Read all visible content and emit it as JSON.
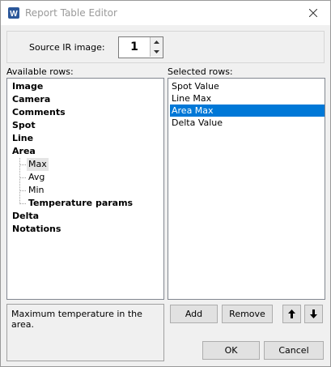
{
  "window": {
    "title": "Report Table Editor"
  },
  "source": {
    "label": "Source IR image:",
    "value": "1"
  },
  "available": {
    "label": "Available rows:",
    "items": [
      "Image",
      "Camera",
      "Comments",
      "Spot",
      "Line",
      "Area"
    ],
    "area_children": [
      "Max",
      "Avg",
      "Min",
      "Temperature params"
    ],
    "after": [
      "Delta",
      "Notations"
    ]
  },
  "selected": {
    "label": "Selected rows:",
    "items": [
      "Spot Value",
      "Line Max",
      "Area Max",
      "Delta Value"
    ],
    "selected_item": "Area Max"
  },
  "description": "Maximum temperature in the area.",
  "buttons": {
    "add": "Add",
    "remove": "Remove",
    "ok": "OK",
    "cancel": "Cancel"
  },
  "colors": {
    "selection": "#0078d7",
    "title_text": "#9a9a9a"
  },
  "icons": {
    "app": "word-icon",
    "close": "close-icon",
    "up": "arrow-up-icon",
    "down": "arrow-down-icon"
  }
}
